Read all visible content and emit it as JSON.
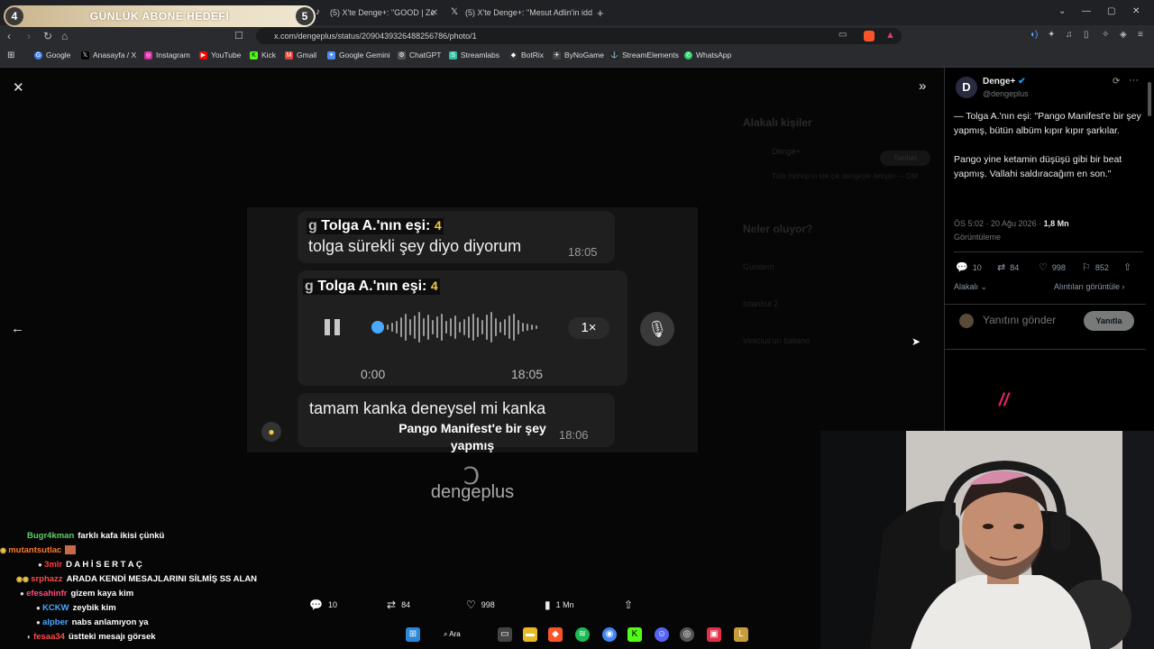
{
  "stream_goal": {
    "left_number": "4",
    "title": "GÜNLÜK ABONE HEDEFİ",
    "right_number": "5"
  },
  "browser": {
    "tabs": [
      {
        "label": "(5) X'te Denge+: \"GOOD | Ze"
      },
      {
        "label": "(5) X'te Denge+: \"Mesut Adlin'in idd"
      }
    ],
    "new_tab": "+",
    "url": "x.com/dengeplus/status/2090439326488256786/photo/1",
    "bookmarks": [
      "Google",
      "Anasayfa / X",
      "Instagram",
      "YouTube",
      "Kick",
      "Gmail",
      "Google Gemini",
      "ChatGPT",
      "Streamlabs",
      "BotRix",
      "ByNoGame",
      "StreamElements",
      "WhatsApp"
    ]
  },
  "photo": {
    "sender1": "Tolga A.'nın eşi:",
    "sender1_num": "4",
    "sender_prefix": "g",
    "msg1": "tolga sürekli şey diyo diyorum",
    "time1": "18:05",
    "sender2": "Tolga A.'nın eşi:",
    "sender2_num": "4",
    "voice_elapsed": "0:00",
    "voice_time": "18:05",
    "speed": "1×",
    "msg3": "tamam kanka deneysel mi kanka",
    "time3": "18:06",
    "caption_line1": "Pango Manifest'e bir şey",
    "caption_line2": "yapmış",
    "watermark": "dengeplus"
  },
  "tweet": {
    "display_name": "Denge+",
    "handle": "@dengeplus",
    "text_p1": "— Tolga A.'nın eşi: \"Pango Manifest'e bir şey yapmış, bütün albüm kıpır kıpır şarkılar.",
    "text_p2": "Pango yine ketamin düşüşü gibi bir beat yapmış. Vallahi saldıracağım en son.\"",
    "timestamp": "ÖS 5:02 · 20 Ağu 2026 ·",
    "views": "1,8 Mn",
    "views_label": "Görüntüleme",
    "replies": "10",
    "retweets": "84",
    "likes": "998",
    "bookmarks": "852",
    "relevance": "Alakalı",
    "quotes_link": "Alıntıları görüntüle",
    "reply_placeholder": "Yanıtını gönder",
    "reply_button": "Yanıtla"
  },
  "bottom_bar": {
    "replies": "10",
    "retweets": "84",
    "likes": "998",
    "views": "1 Mn"
  },
  "bg_sidebar": {
    "related_title": "Alakalı kişiler",
    "related_name": "Denge+",
    "follow": "Takibet",
    "bio": "Türk hiphop'ın tek çık dengeyle iletişim — DM",
    "trending_title": "Neler oluyor?",
    "trend1": "Gündem",
    "trend2": "Istanbul 2",
    "trend3": "Vinicius'un Italiano"
  },
  "chat": [
    {
      "user": "Bugr4kman",
      "color": "#5fd068",
      "text": "farklı kafa ikisi çünkü"
    },
    {
      "user": "mutantsutlac",
      "color": "#ff7a2a",
      "text": ""
    },
    {
      "user": "3mlr",
      "color": "#ff3b3b",
      "text": "D A H İ S E R T A Ç"
    },
    {
      "user": "srphazz",
      "color": "#ff4a4a",
      "text": "ARADA KENDİ MESAJLARINI SİLMİŞ SS ALAN"
    },
    {
      "user": "efesahinfr",
      "color": "#ff4d7a",
      "text": "gizem kaya kim"
    },
    {
      "user": "KCKW",
      "color": "#4aa8ff",
      "text": "zeybik kim"
    },
    {
      "user": "alpber",
      "color": "#4aa8ff",
      "text": "nabs anlamıyon ya"
    },
    {
      "user": "fesaa34",
      "color": "#ff4a4a",
      "text": "üstteki mesajı görsek"
    }
  ],
  "taskbar": {
    "search_label": "Ara"
  },
  "colors": {
    "accent": "#1d9bf0",
    "goal_gold": "#e9dcc0",
    "sender_num": "#f2c744"
  }
}
